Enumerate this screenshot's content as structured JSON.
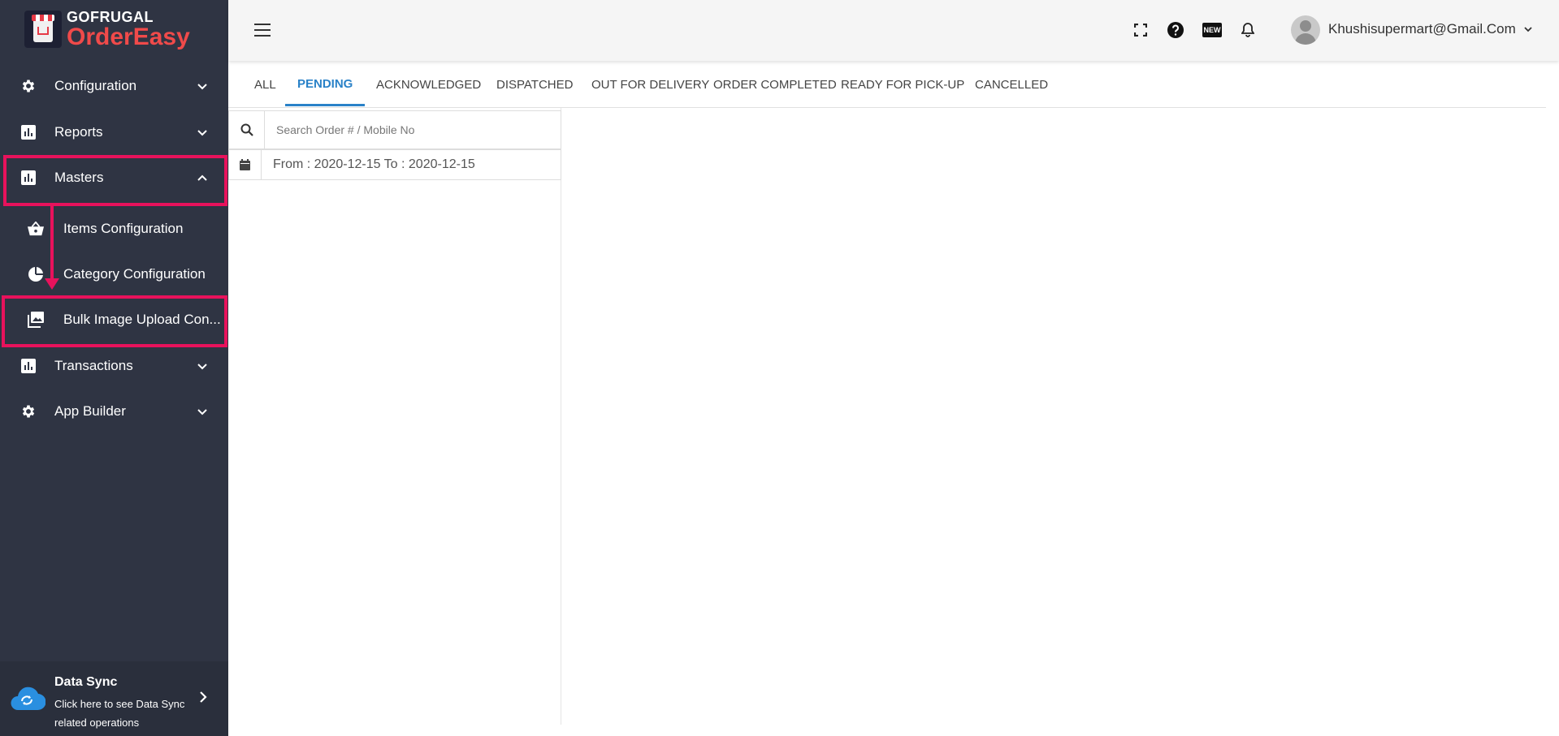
{
  "brand": {
    "line1": "GOFRUGAL",
    "line2": "OrderEasy"
  },
  "sidebar": {
    "items": [
      {
        "label": "Configuration",
        "icon": "gear-icon",
        "expanded": false
      },
      {
        "label": "Reports",
        "icon": "bar-chart-icon",
        "expanded": false
      },
      {
        "label": "Masters",
        "icon": "bar-chart-icon",
        "expanded": true
      },
      {
        "label": "Transactions",
        "icon": "bar-chart-icon",
        "expanded": false
      },
      {
        "label": "App Builder",
        "icon": "gear-icon",
        "expanded": false
      }
    ],
    "masters_sub": [
      {
        "label": "Items Configuration",
        "icon": "basket-icon"
      },
      {
        "label": "Category Configuration",
        "icon": "pie-chart-icon"
      },
      {
        "label": "Bulk Image Upload Con...",
        "icon": "images-icon"
      }
    ],
    "data_sync": {
      "title": "Data Sync",
      "description": "Click here to see Data Sync related operations"
    }
  },
  "header": {
    "user_email": "Khushisupermart@Gmail.Com",
    "icons": [
      "fullscreen-icon",
      "help-icon",
      "new-badge-icon",
      "bell-icon"
    ],
    "new_badge": "NEW"
  },
  "tabs": [
    {
      "label": "ALL",
      "active": false
    },
    {
      "label": "PENDING",
      "active": true
    },
    {
      "label": "ACKNOWLEDGED",
      "active": false
    },
    {
      "label": "DISPATCHED",
      "active": false
    },
    {
      "label": "OUT FOR DELIVERY",
      "active": false
    },
    {
      "label": "ORDER COMPLETED",
      "active": false
    },
    {
      "label": "READY FOR PICK-UP",
      "active": false
    },
    {
      "label": "CANCELLED",
      "active": false
    }
  ],
  "search": {
    "placeholder": "Search Order # / Mobile No",
    "value": ""
  },
  "date_filter": {
    "text": "From : 2020-12-15 To : 2020-12-15"
  },
  "colors": {
    "sidebar_bg": "#2f3443",
    "accent": "#2a82c8",
    "highlight": "#e8125c",
    "brand_red": "#f04a4a"
  }
}
